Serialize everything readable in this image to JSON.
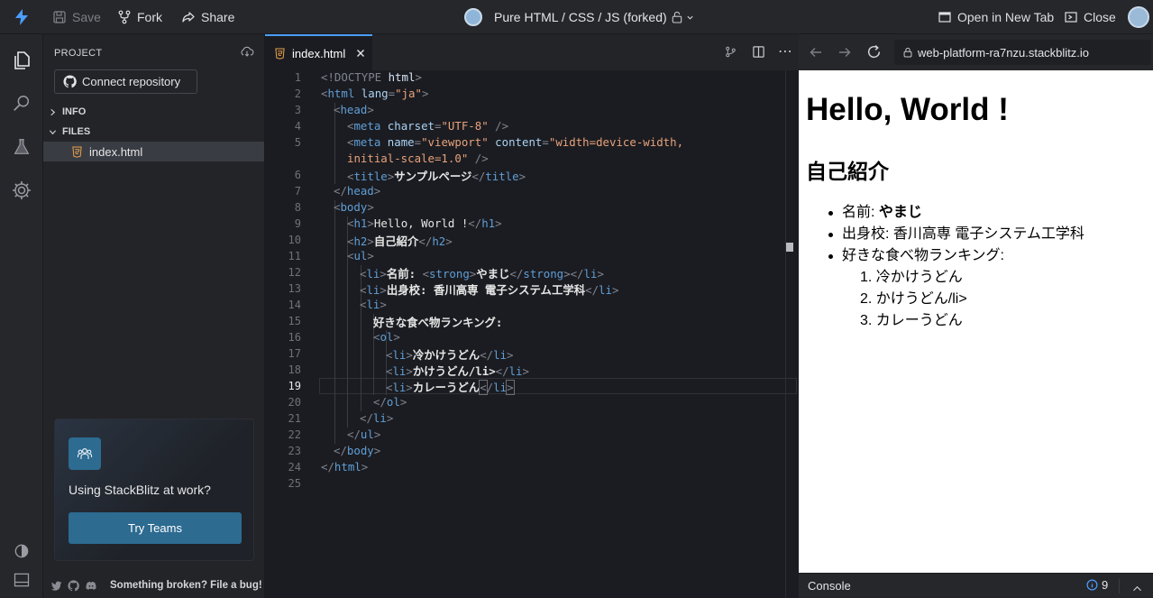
{
  "topbar": {
    "save_label": "Save",
    "fork_label": "Fork",
    "share_label": "Share",
    "project_title": "Pure HTML / CSS / JS (forked)",
    "open_new_tab_label": "Open in New Tab",
    "close_label": "Close"
  },
  "sidebar": {
    "project_heading": "PROJECT",
    "connect_repo_label": "Connect repository",
    "info_label": "INFO",
    "files_label": "FILES",
    "file_name": "index.html",
    "promo_title": "Using StackBlitz at work?",
    "promo_button": "Try Teams",
    "footer_text": "Something broken? File a bug!"
  },
  "editor": {
    "tab_label": "index.html",
    "line_numbers": [
      "1",
      "2",
      "3",
      "4",
      "5",
      "",
      "6",
      "7",
      "8",
      "9",
      "10",
      "11",
      "12",
      "13",
      "14",
      "15",
      "16",
      "17",
      "18",
      "19",
      "20",
      "21",
      "22",
      "23",
      "24",
      "25"
    ],
    "current_line": "19"
  },
  "code": {
    "l1": [
      "<!DOCTYPE",
      " html",
      ">"
    ],
    "l2": [
      "<",
      "html",
      " lang",
      "=",
      "\"ja\"",
      ">"
    ],
    "l3": [
      "<",
      "head",
      ">"
    ],
    "l4": [
      "<",
      "meta",
      " charset",
      "=",
      "\"UTF-8\"",
      " />"
    ],
    "l5a": [
      "<",
      "meta",
      " name",
      "=",
      "\"viewport\"",
      " content",
      "=",
      "\"width=device-width,"
    ],
    "l5b": [
      "initial-scale=1.0\"",
      " />"
    ],
    "l6": [
      "<",
      "title",
      ">",
      "サンプルページ",
      "</",
      "title",
      ">"
    ],
    "l7": [
      "</",
      "head",
      ">"
    ],
    "l8": [
      "<",
      "body",
      ">"
    ],
    "l9": [
      "<",
      "h1",
      ">",
      "Hello, World !",
      "</",
      "h1",
      ">"
    ],
    "l10": [
      "<",
      "h2",
      ">",
      "自己紹介",
      "</",
      "h2",
      ">"
    ],
    "l11": [
      "<",
      "ul",
      ">"
    ],
    "l12": [
      "<",
      "li",
      ">",
      "名前: ",
      "<",
      "strong",
      ">",
      "やまじ",
      "</",
      "strong",
      "></",
      "li",
      ">"
    ],
    "l13": [
      "<",
      "li",
      ">",
      "出身校: 香川高専 電子システム工学科",
      "</",
      "li",
      ">"
    ],
    "l14": [
      "<",
      "li",
      ">"
    ],
    "l15": [
      "好きな食べ物ランキング:"
    ],
    "l16": [
      "<",
      "ol",
      ">"
    ],
    "l17": [
      "<",
      "li",
      ">",
      "冷かけうどん",
      "</",
      "li",
      ">"
    ],
    "l18": [
      "<",
      "li",
      ">",
      "かけうどん/li>",
      "</",
      "li",
      ">"
    ],
    "l19": [
      "<",
      "li",
      ">",
      "カレーうどん",
      "<",
      "/",
      "li",
      ">"
    ],
    "l20": [
      "</",
      "ol",
      ">"
    ],
    "l21": [
      "</",
      "li",
      ">"
    ],
    "l22": [
      "</",
      "ul",
      ">"
    ],
    "l23": [
      "</",
      "body",
      ">"
    ],
    "l24": [
      "</",
      "html",
      ">"
    ]
  },
  "preview": {
    "url": "web-platform-ra7nzu.stackblitz.io",
    "h1": "Hello, World !",
    "h2": "自己紹介",
    "name_label": "名前: ",
    "name_value": "やまじ",
    "school": "出身校: 香川高専 電子システム工学科",
    "food_label": "好きな食べ物ランキング:",
    "food_items": [
      "冷かけうどん",
      "かけうどん/li>",
      "カレーうどん"
    ]
  },
  "console": {
    "label": "Console",
    "count": "9"
  },
  "colors": {
    "accent_blue": "#4a9eff",
    "promo_button": "#2d6b91",
    "html_file_icon": "#e8a04b"
  }
}
